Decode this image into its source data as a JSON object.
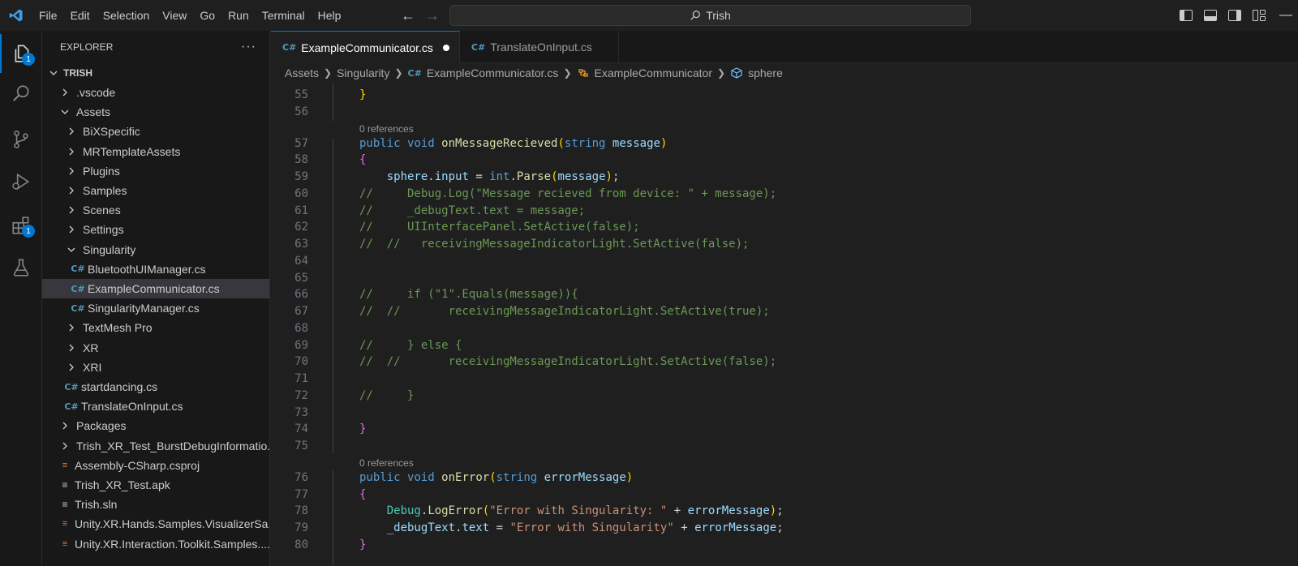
{
  "menu": [
    "File",
    "Edit",
    "Selection",
    "View",
    "Go",
    "Run",
    "Terminal",
    "Help"
  ],
  "search": {
    "text": "Trish"
  },
  "activity_bar": {
    "explorer_badge": "1",
    "extensions_badge": "1"
  },
  "sidebar": {
    "title": "EXPLORER",
    "more": "···",
    "root": "TRISH",
    "items": [
      {
        "label": ".vscode",
        "kind": "folder-closed",
        "depth": 1
      },
      {
        "label": "Assets",
        "kind": "folder-open",
        "depth": 1
      },
      {
        "label": "BiXSpecific",
        "kind": "folder-closed",
        "depth": 2
      },
      {
        "label": "MRTemplateAssets",
        "kind": "folder-closed",
        "depth": 2
      },
      {
        "label": "Plugins",
        "kind": "folder-closed",
        "depth": 2
      },
      {
        "label": "Samples",
        "kind": "folder-closed",
        "depth": 2
      },
      {
        "label": "Scenes",
        "kind": "folder-closed",
        "depth": 2
      },
      {
        "label": "Settings",
        "kind": "folder-closed",
        "depth": 2
      },
      {
        "label": "Singularity",
        "kind": "folder-open",
        "depth": 2
      },
      {
        "label": "BluetoothUIManager.cs",
        "kind": "cs",
        "depth": 3
      },
      {
        "label": "ExampleCommunicator.cs",
        "kind": "cs",
        "depth": 3,
        "selected": true
      },
      {
        "label": "SingularityManager.cs",
        "kind": "cs",
        "depth": 3
      },
      {
        "label": "TextMesh Pro",
        "kind": "folder-closed",
        "depth": 2
      },
      {
        "label": "XR",
        "kind": "folder-closed",
        "depth": 2
      },
      {
        "label": "XRI",
        "kind": "folder-closed",
        "depth": 2
      },
      {
        "label": "startdancing.cs",
        "kind": "cs",
        "depth": 2
      },
      {
        "label": "TranslateOnInput.cs",
        "kind": "cs",
        "depth": 2
      },
      {
        "label": "Packages",
        "kind": "folder-closed",
        "depth": 1
      },
      {
        "label": "Trish_XR_Test_BurstDebugInformatio...",
        "kind": "folder-closed",
        "depth": 1
      },
      {
        "label": "Assembly-CSharp.csproj",
        "kind": "rss",
        "depth": 1
      },
      {
        "label": "Trish_XR_Test.apk",
        "kind": "lines",
        "depth": 1
      },
      {
        "label": "Trish.sln",
        "kind": "lines",
        "depth": 1
      },
      {
        "label": "Unity.XR.Hands.Samples.VisualizerSa...",
        "kind": "rss",
        "depth": 1
      },
      {
        "label": "Unity.XR.Interaction.Toolkit.Samples....",
        "kind": "rss",
        "depth": 1
      }
    ]
  },
  "tabs": [
    {
      "label": "ExampleCommunicator.cs",
      "active": true,
      "dirty": true
    },
    {
      "label": "TranslateOnInput.cs",
      "active": false,
      "dirty": false
    }
  ],
  "breadcrumb": {
    "assets": "Assets",
    "singularity": "Singularity",
    "file": "ExampleCommunicator.cs",
    "class": "ExampleCommunicator",
    "member": "sphere"
  },
  "editor": {
    "codelens": "0 references",
    "lines": [
      {
        "n": "55",
        "indent": 2,
        "tokens": [
          [
            "br2",
            "}"
          ]
        ]
      },
      {
        "n": "56",
        "indent": 0,
        "tokens": []
      },
      {
        "lens": true
      },
      {
        "n": "57",
        "indent": 2,
        "tokens": [
          [
            "kw",
            "public"
          ],
          [
            "pl",
            " "
          ],
          [
            "kw",
            "void"
          ],
          [
            "pl",
            " "
          ],
          [
            "fn",
            "onMessageRecieved"
          ],
          [
            "br2",
            "("
          ],
          [
            "kw",
            "string"
          ],
          [
            "pl",
            " "
          ],
          [
            "var",
            "message"
          ],
          [
            "br2",
            ")"
          ]
        ]
      },
      {
        "n": "58",
        "indent": 2,
        "tokens": [
          [
            "br",
            "{"
          ]
        ]
      },
      {
        "n": "59",
        "indent": 3,
        "tokens": [
          [
            "var",
            "sphere"
          ],
          [
            "pl",
            "."
          ],
          [
            "var",
            "input"
          ],
          [
            "pl",
            " = "
          ],
          [
            "kw",
            "int"
          ],
          [
            "pl",
            "."
          ],
          [
            "fn",
            "Parse"
          ],
          [
            "br2",
            "("
          ],
          [
            "var",
            "message"
          ],
          [
            "br2",
            ")"
          ],
          [
            "pl",
            ";"
          ]
        ]
      },
      {
        "n": "60",
        "indent": 2,
        "tokens": [
          [
            "cm",
            "//     Debug.Log(\"Message recieved from device: \" + message);"
          ]
        ]
      },
      {
        "n": "61",
        "indent": 2,
        "tokens": [
          [
            "cm",
            "//     _debugText.text = message;"
          ]
        ]
      },
      {
        "n": "62",
        "indent": 2,
        "tokens": [
          [
            "cm",
            "//     UIInterfacePanel.SetActive(false);"
          ]
        ]
      },
      {
        "n": "63",
        "indent": 2,
        "tokens": [
          [
            "cm",
            "//  //   receivingMessageIndicatorLight.SetActive(false);"
          ]
        ]
      },
      {
        "n": "64",
        "indent": 0,
        "tokens": []
      },
      {
        "n": "65",
        "indent": 0,
        "tokens": []
      },
      {
        "n": "66",
        "indent": 2,
        "tokens": [
          [
            "cm",
            "//     if (\"1\".Equals(message)){"
          ]
        ]
      },
      {
        "n": "67",
        "indent": 2,
        "tokens": [
          [
            "cm",
            "//  //       receivingMessageIndicatorLight.SetActive(true);"
          ]
        ]
      },
      {
        "n": "68",
        "indent": 0,
        "tokens": []
      },
      {
        "n": "69",
        "indent": 2,
        "tokens": [
          [
            "cm",
            "//     } else {"
          ]
        ]
      },
      {
        "n": "70",
        "indent": 2,
        "tokens": [
          [
            "cm",
            "//  //       receivingMessageIndicatorLight.SetActive(false);"
          ]
        ]
      },
      {
        "n": "71",
        "indent": 0,
        "tokens": []
      },
      {
        "n": "72",
        "indent": 2,
        "tokens": [
          [
            "cm",
            "//     }"
          ]
        ]
      },
      {
        "n": "73",
        "indent": 0,
        "tokens": []
      },
      {
        "n": "74",
        "indent": 2,
        "tokens": [
          [
            "br",
            "}"
          ]
        ]
      },
      {
        "n": "75",
        "indent": 0,
        "tokens": []
      },
      {
        "lens": true
      },
      {
        "n": "76",
        "indent": 2,
        "tokens": [
          [
            "kw",
            "public"
          ],
          [
            "pl",
            " "
          ],
          [
            "kw",
            "void"
          ],
          [
            "pl",
            " "
          ],
          [
            "fn",
            "onError"
          ],
          [
            "br2",
            "("
          ],
          [
            "kw",
            "string"
          ],
          [
            "pl",
            " "
          ],
          [
            "var",
            "errorMessage"
          ],
          [
            "br2",
            ")"
          ]
        ]
      },
      {
        "n": "77",
        "indent": 2,
        "tokens": [
          [
            "br",
            "{"
          ]
        ]
      },
      {
        "n": "78",
        "indent": 3,
        "tokens": [
          [
            "ty",
            "Debug"
          ],
          [
            "pl",
            "."
          ],
          [
            "fn",
            "LogError"
          ],
          [
            "br2",
            "("
          ],
          [
            "str",
            "\"Error with Singularity: \""
          ],
          [
            "pl",
            " + "
          ],
          [
            "var",
            "errorMessage"
          ],
          [
            "br2",
            ")"
          ],
          [
            "pl",
            ";"
          ]
        ]
      },
      {
        "n": "79",
        "indent": 3,
        "tokens": [
          [
            "var",
            "_debugText"
          ],
          [
            "pl",
            "."
          ],
          [
            "var",
            "text"
          ],
          [
            "pl",
            " = "
          ],
          [
            "str",
            "\"Error with Singularity\""
          ],
          [
            "pl",
            " + "
          ],
          [
            "var",
            "errorMessage"
          ],
          [
            "pl",
            ";"
          ]
        ]
      },
      {
        "n": "80",
        "indent": 2,
        "tokens": [
          [
            "br",
            "}"
          ]
        ]
      }
    ]
  }
}
